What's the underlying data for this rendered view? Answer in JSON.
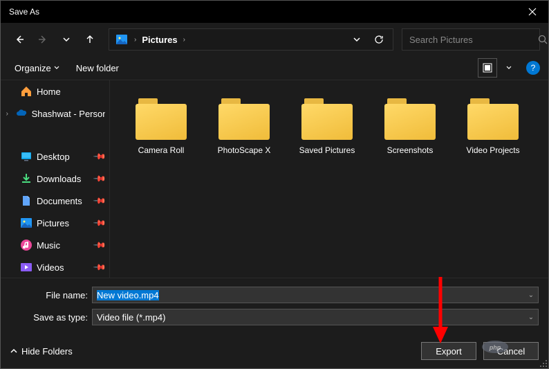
{
  "window": {
    "title": "Save As"
  },
  "nav": {
    "breadcrumb": "Pictures"
  },
  "search": {
    "placeholder": "Search Pictures"
  },
  "toolbar": {
    "organize": "Organize",
    "newfolder": "New folder"
  },
  "sidebar": {
    "home": "Home",
    "onedrive": "Shashwat - Personal",
    "desktop": "Desktop",
    "downloads": "Downloads",
    "documents": "Documents",
    "pictures": "Pictures",
    "music": "Music",
    "videos": "Videos"
  },
  "folders": [
    {
      "label": "Camera Roll"
    },
    {
      "label": "PhotoScape X"
    },
    {
      "label": "Saved Pictures"
    },
    {
      "label": "Screenshots"
    },
    {
      "label": "Video Projects"
    }
  ],
  "form": {
    "filename_label": "File name:",
    "filename_value": "New video.mp4",
    "saveas_label": "Save as type:",
    "saveas_value": "Video file (*.mp4)"
  },
  "footer": {
    "hidefolders": "Hide Folders",
    "export": "Export",
    "cancel": "Cancel"
  },
  "help": "?"
}
